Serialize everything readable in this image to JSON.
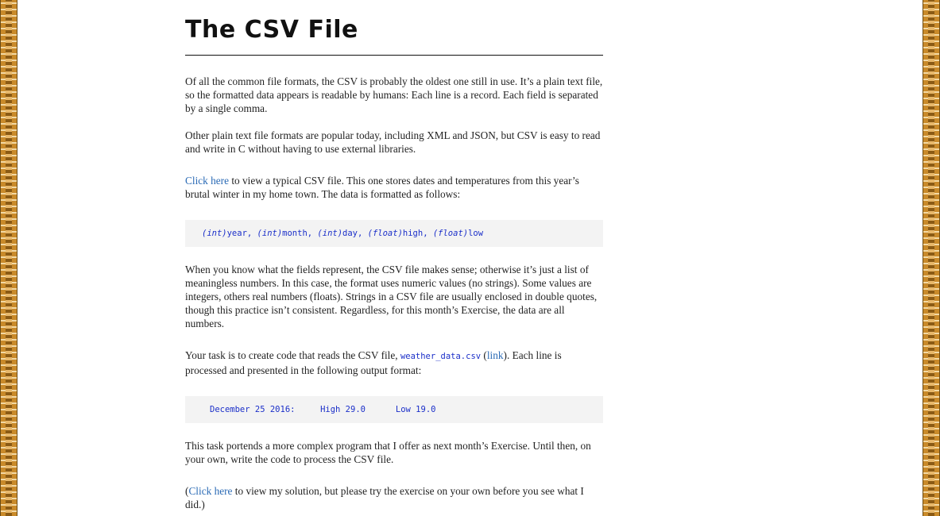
{
  "article": {
    "title": "The CSV File",
    "p1": "Of all the common file formats, the CSV is probably the oldest one still in use. It’s a plain text file, so the formatted data appears is readable by humans: Each line is a record. Each field is separated by a single comma.",
    "p2": "Other plain text file formats are popular today, including XML and JSON, but CSV is easy to read and write in C without having to use external libraries.",
    "p3_link": "Click here",
    "p3_rest": " to view a typical CSV file. This one stores dates and temperatures from this year’s brutal winter in my home town. The data is formatted as follows:",
    "format_code": {
      "int1": "(int)",
      "year": "year, ",
      "int2": "(int)",
      "month": "month, ",
      "int3": "(int)",
      "day": "day, ",
      "float1": "(float)",
      "high": "high, ",
      "float2": "(float)",
      "low": "low"
    },
    "p4": "When you know what the fields represent, the CSV file makes sense; otherwise it’s just a list of meaningless numbers. In this case, the format uses numeric values (no strings). Some values are integers, others real numbers (floats). Strings in a CSV file are usually enclosed in double quotes, though this practice isn’t consistent. Regardless, for this month’s Exercise, the data are all numbers.",
    "p5_start": "Your task is to create code that reads the CSV file, ",
    "p5_code": "weather_data.csv",
    "p5_paren_open": " (",
    "p5_link": "link",
    "p5_rest": "). Each line is processed and presented in the following output format:",
    "output_code": "December 25 2016:     High 29.0      Low 19.0",
    "p6": "This task portends a more complex program that I offer as next month’s Exercise. Until then, on your own, write the code to process the CSV file.",
    "p7_open": "(",
    "p7_link": "Click here",
    "p7_rest": " to view my solution, but please try the exercise on your own before you see what I did.)"
  },
  "colors": {
    "link": "#2a6ab5",
    "code": "#1b2fc9",
    "code_bg": "#f3f3f3",
    "border": "#c98a2a"
  }
}
